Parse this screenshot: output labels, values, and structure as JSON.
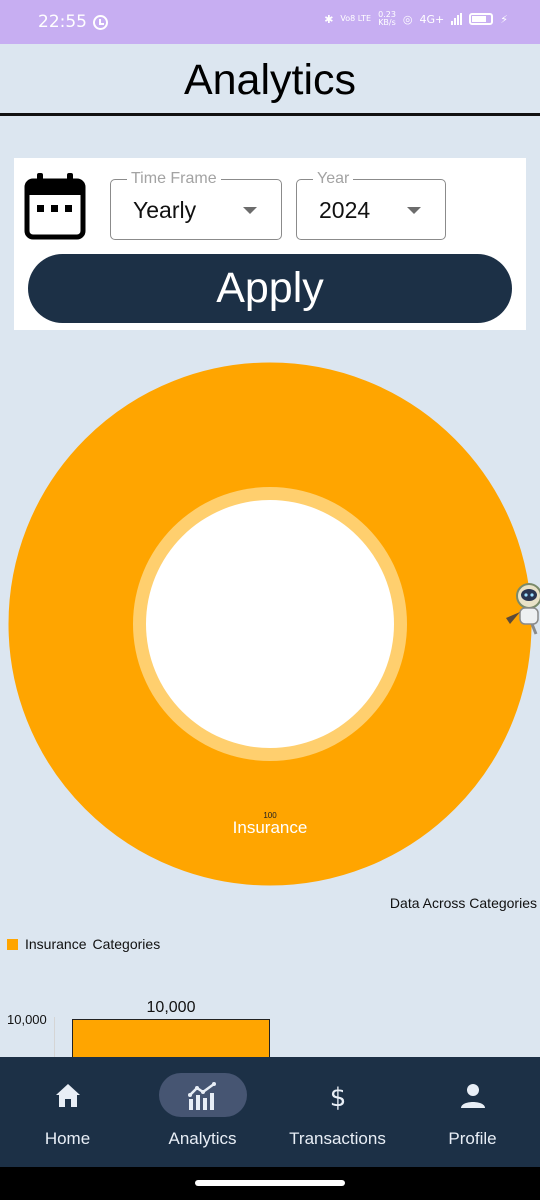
{
  "status_bar": {
    "time": "22:55",
    "volte": "Vo8 LTE",
    "speed_value": "0.23",
    "speed_unit": "KB/s",
    "network": "4G+"
  },
  "header": {
    "title": "Analytics"
  },
  "filters": {
    "time_frame": {
      "label": "Time Frame",
      "value": "Yearly"
    },
    "year": {
      "label": "Year",
      "value": "2024"
    },
    "apply_label": "Apply"
  },
  "donut": {
    "segment_label": "Insurance",
    "segment_value": "100",
    "caption": "Data Across Categories"
  },
  "legend": {
    "item": "Insurance",
    "title": "Categories"
  },
  "chart_data": {
    "type": "bar",
    "categories": [
      "Insurance"
    ],
    "values": [
      10000
    ],
    "value_label": "10,000",
    "y_tick_label": "10,000",
    "color": "#ffa500"
  },
  "nav": {
    "items": [
      {
        "label": "Home",
        "icon": "home-icon"
      },
      {
        "label": "Analytics",
        "icon": "analytics-icon",
        "active": true
      },
      {
        "label": "Transactions",
        "icon": "dollar-icon"
      },
      {
        "label": "Profile",
        "icon": "person-icon"
      }
    ]
  },
  "colors": {
    "background": "#dce6f0",
    "status_bar": "#c7aef2",
    "primary_dark": "#1c3046",
    "accent": "#ffa500",
    "active_pill": "#465572"
  }
}
